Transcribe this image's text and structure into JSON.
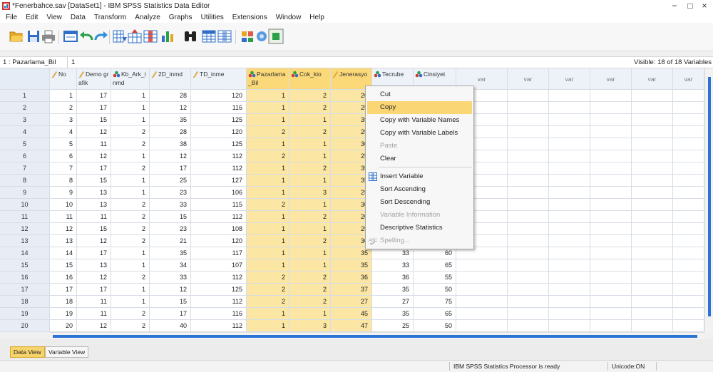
{
  "window": {
    "title": "*Fenerbahce.sav [DataSet1] - IBM SPSS Statistics Data Editor",
    "minimize": "−",
    "maximize": "□",
    "close": "×"
  },
  "menubar": [
    "File",
    "Edit",
    "View",
    "Data",
    "Transform",
    "Analyze",
    "Graphs",
    "Utilities",
    "Extensions",
    "Window",
    "Help"
  ],
  "toolbar": [
    "open-data-icon",
    "save-icon",
    "print-icon",
    "dialog-recall-icon",
    "undo-icon",
    "redo-icon",
    "go-to-case-icon",
    "go-to-variable-icon",
    "variables-icon",
    "descriptive-statistics-icon",
    "find-icon",
    "insert-cases-icon",
    "insert-variable-icon",
    "split-file-icon",
    "weight-cases-icon",
    "select-cases-icon"
  ],
  "cell_editor": {
    "reference": "1 : Pazarlama_Bil",
    "value": "1",
    "visible_variables": "Visible: 18 of 18 Variables"
  },
  "columns": [
    {
      "label": "No",
      "measure": "scale",
      "selected": false
    },
    {
      "label": "Demo grafik",
      "measure": "scale",
      "selected": false
    },
    {
      "label": "Kb_Ark_inmd",
      "measure": "nominal",
      "selected": false
    },
    {
      "label": "2D_inmd",
      "measure": "scale",
      "selected": false
    },
    {
      "label": "TD_inme",
      "measure": "scale",
      "selected": false
    },
    {
      "label": "Pazarlama_Bil",
      "measure": "nominal",
      "selected": true
    },
    {
      "label": "Cok_kio",
      "measure": "nominal",
      "selected": true
    },
    {
      "label": "Jenerasyo",
      "measure": "scale",
      "selected": true
    },
    {
      "label": "Tecrube",
      "measure": "nominal",
      "selected": false
    },
    {
      "label": "Cinsiyet",
      "measure": "nominal",
      "selected": false
    }
  ],
  "var_columns": [
    "var",
    "var",
    "var",
    "var",
    "var",
    "var"
  ],
  "rows": [
    {
      "n": "1",
      "cells": [
        "1",
        "17",
        "1",
        "28",
        "120",
        "1",
        "2",
        "20",
        "",
        ""
      ]
    },
    {
      "n": "2",
      "cells": [
        "2",
        "17",
        "1",
        "12",
        "116",
        "1",
        "2",
        "25",
        "",
        ""
      ]
    },
    {
      "n": "3",
      "cells": [
        "3",
        "15",
        "1",
        "35",
        "125",
        "1",
        "1",
        "35",
        "",
        ""
      ]
    },
    {
      "n": "4",
      "cells": [
        "4",
        "12",
        "2",
        "28",
        "120",
        "2",
        "2",
        "25",
        "",
        ""
      ]
    },
    {
      "n": "5",
      "cells": [
        "5",
        "11",
        "2",
        "38",
        "125",
        "1",
        "1",
        "30",
        "",
        ""
      ]
    },
    {
      "n": "6",
      "cells": [
        "6",
        "12",
        "1",
        "12",
        "112",
        "2",
        "1",
        "25",
        "",
        ""
      ]
    },
    {
      "n": "7",
      "cells": [
        "7",
        "17",
        "2",
        "17",
        "112",
        "1",
        "2",
        "35",
        "",
        ""
      ]
    },
    {
      "n": "8",
      "cells": [
        "8",
        "15",
        "1",
        "25",
        "127",
        "1",
        "1",
        "35",
        "",
        ""
      ]
    },
    {
      "n": "9",
      "cells": [
        "9",
        "13",
        "1",
        "23",
        "106",
        "1",
        "3",
        "25",
        "",
        ""
      ]
    },
    {
      "n": "10",
      "cells": [
        "10",
        "13",
        "2",
        "33",
        "115",
        "2",
        "1",
        "30",
        "",
        ""
      ]
    },
    {
      "n": "11",
      "cells": [
        "11",
        "11",
        "2",
        "15",
        "112",
        "1",
        "2",
        "20",
        "",
        ""
      ]
    },
    {
      "n": "12",
      "cells": [
        "12",
        "15",
        "2",
        "23",
        "108",
        "1",
        "1",
        "25",
        "",
        ""
      ]
    },
    {
      "n": "13",
      "cells": [
        "13",
        "12",
        "2",
        "21",
        "120",
        "1",
        "2",
        "30",
        "",
        ""
      ]
    },
    {
      "n": "14",
      "cells": [
        "14",
        "17",
        "1",
        "35",
        "117",
        "1",
        "1",
        "35",
        "33",
        "60"
      ]
    },
    {
      "n": "15",
      "cells": [
        "15",
        "13",
        "1",
        "34",
        "107",
        "1",
        "1",
        "35",
        "33",
        "65"
      ]
    },
    {
      "n": "16",
      "cells": [
        "16",
        "12",
        "2",
        "33",
        "112",
        "2",
        "2",
        "36",
        "36",
        "55"
      ]
    },
    {
      "n": "17",
      "cells": [
        "17",
        "17",
        "1",
        "12",
        "125",
        "2",
        "2",
        "37",
        "35",
        "50"
      ]
    },
    {
      "n": "18",
      "cells": [
        "18",
        "11",
        "1",
        "15",
        "112",
        "2",
        "2",
        "27",
        "27",
        "75"
      ]
    },
    {
      "n": "19",
      "cells": [
        "19",
        "11",
        "2",
        "17",
        "116",
        "1",
        "1",
        "45",
        "35",
        "65"
      ]
    },
    {
      "n": "20",
      "cells": [
        "20",
        "12",
        "2",
        "40",
        "112",
        "1",
        "3",
        "47",
        "25",
        "50"
      ]
    }
  ],
  "context_menu": {
    "items": [
      {
        "label": "Cut",
        "enabled": true
      },
      {
        "label": "Copy",
        "enabled": true,
        "highlighted": true
      },
      {
        "label": "Copy with Variable Names",
        "enabled": true
      },
      {
        "label": "Copy with Variable Labels",
        "enabled": true
      },
      {
        "label": "Paste",
        "enabled": false
      },
      {
        "label": "Clear",
        "enabled": true
      },
      {
        "label": "Insert Variable",
        "enabled": true,
        "icon": "insert-variable-icon"
      },
      {
        "label": "Sort Ascending",
        "enabled": true
      },
      {
        "label": "Sort Descending",
        "enabled": true
      },
      {
        "label": "Variable Information",
        "enabled": false
      },
      {
        "label": "Descriptive Statistics",
        "enabled": true
      },
      {
        "label": "Spelling...",
        "enabled": false,
        "icon": "spell-check-icon"
      }
    ]
  },
  "tabs": [
    {
      "label": "Data View",
      "active": true
    },
    {
      "label": "Variable View",
      "active": false
    }
  ],
  "status_bar": {
    "message": "IBM SPSS Statistics Processor is ready",
    "unicode": "Unicode:ON"
  },
  "colors": {
    "selection": "#fbe6a4",
    "selection_header": "#fcd978",
    "menu_highlight": "#fbd675",
    "active_tab": "#f7d36b",
    "scroll_thumb": "#2b74d6"
  }
}
